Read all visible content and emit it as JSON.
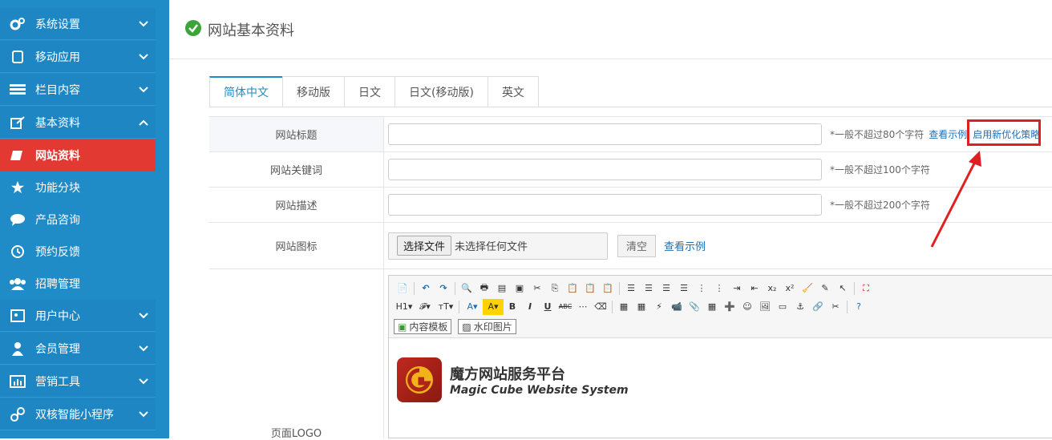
{
  "sidebar": {
    "items": [
      {
        "label": "系统设置",
        "icon": "gears-icon"
      },
      {
        "label": "移动应用",
        "icon": "mobile-icon"
      },
      {
        "label": "栏目内容",
        "icon": "list-icon"
      },
      {
        "label": "基本资料",
        "icon": "edit-icon"
      },
      {
        "label": "网站资料",
        "icon": "book-icon"
      },
      {
        "label": "功能分块",
        "icon": "star-icon"
      },
      {
        "label": "产品咨询",
        "icon": "chat-icon"
      },
      {
        "label": "预约反馈",
        "icon": "history-icon"
      },
      {
        "label": "招聘管理",
        "icon": "users-icon"
      },
      {
        "label": "用户中心",
        "icon": "id-card-icon"
      },
      {
        "label": "会员管理",
        "icon": "user-icon"
      },
      {
        "label": "营销工具",
        "icon": "bar-chart-icon"
      },
      {
        "label": "双核智能小程序",
        "icon": "link-icon"
      }
    ]
  },
  "header": {
    "title": "网站基本资料",
    "icon": "check-circle-icon"
  },
  "tabs": [
    "简体中文",
    "移动版",
    "日文",
    "日文(移动版)",
    "英文"
  ],
  "form": {
    "title_label": "网站标题",
    "title_hint": "*一般不超过80个字符",
    "title_example": "查看示例",
    "title_optimize": "启用新优化策略",
    "keywords_label": "网站关键词",
    "keywords_hint": "*一般不超过100个字符",
    "desc_label": "网站描述",
    "desc_hint": "*一般不超过200个字符",
    "favicon_label": "网站图标",
    "file_button": "选择文件",
    "file_status": "未选择任何文件",
    "clear_button": "清空",
    "favicon_example": "查看示例",
    "logo_label": "页面LOGO"
  },
  "editor": {
    "template_button": "内容模板",
    "watermark_button": "水印图片",
    "logo_cn": "魔方网站服务平台",
    "logo_en": "Magic Cube Website System"
  },
  "colors": {
    "sidebar": "#1f8bc7",
    "active": "#e23a33",
    "link": "#1f6fb3",
    "highlight": "#e02020"
  }
}
